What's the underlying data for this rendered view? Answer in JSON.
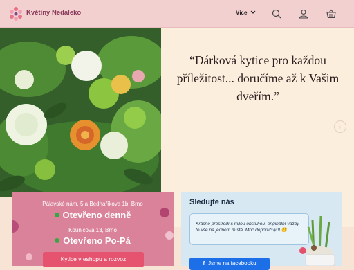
{
  "header": {
    "brand": "Květiny Nedaleko",
    "menu_label": "Více",
    "colors": {
      "bar": "#f2d0d0",
      "brand_text": "#8a3a5a"
    },
    "icons": [
      "logo-icon",
      "chevron-down-icon",
      "search-icon",
      "user-icon",
      "basket-icon"
    ]
  },
  "hero": {
    "quote": "“Dárková kytice pro každou příležitost... doručíme až k Vašim dveřím.”",
    "image_alt": "bouquet-photo",
    "next_icon": "chevron-right-icon"
  },
  "stores": {
    "store1_address": "Pálavské nám. 5 a Bednaříkova 1b, Brno",
    "store1_status": "Otevřeno denně",
    "store2_address": "Kounicova 13, Brno",
    "store2_status": "Otevřeno Po-Pá",
    "shop_button": "Kytice v eshopu a rozvoz",
    "colors": {
      "card": "#d9829a",
      "open_dot": "#35a844",
      "button": "#e5536f"
    }
  },
  "social": {
    "title": "Sledujte nás",
    "review": "Krásné prostředí s milou obsluhou, originální vazby, to vše na jednom místě. Moc doporučuji!!! 😊",
    "facebook_button": "Jsme na facebooku",
    "colors": {
      "card": "#d7e8f3",
      "button": "#1d6fe8"
    }
  }
}
